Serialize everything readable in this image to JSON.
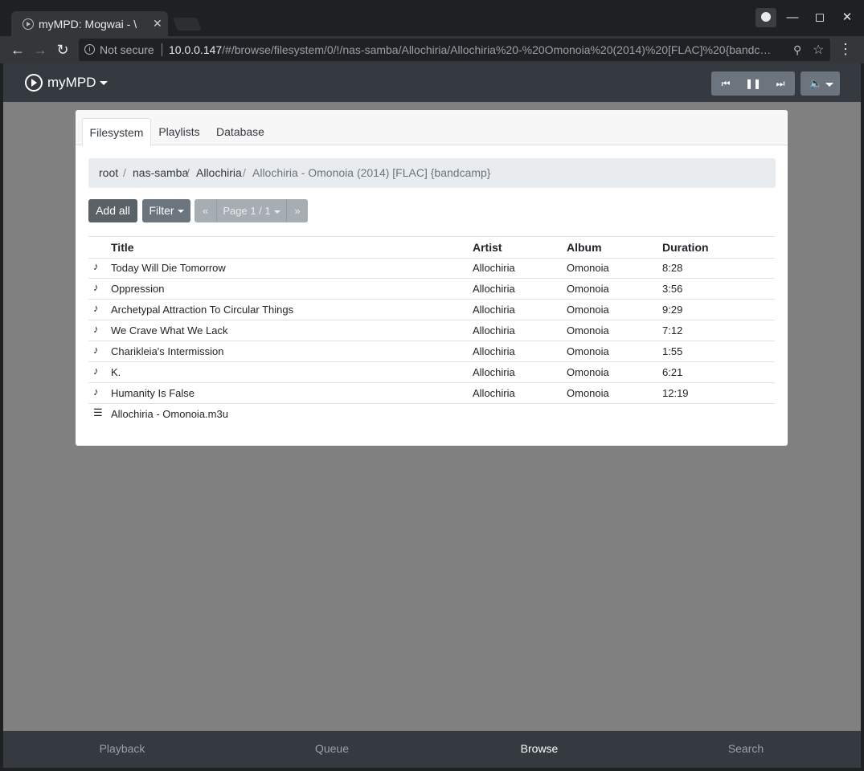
{
  "browser": {
    "tab_title": "myMPD: Mogwai - \\",
    "tab_close": "✕",
    "security_label": "Not secure",
    "url_host": "10.0.0.147",
    "url_path": "/#/browse/filesystem/0/!/nas-samba/Allochiria/Allochiria%20-%20Omonoia%20(2014)%20[FLAC]%20{bandc…"
  },
  "app": {
    "brand": "myMPD",
    "tabs": [
      "Filesystem",
      "Playlists",
      "Database"
    ],
    "active_tab": "Filesystem",
    "breadcrumb": [
      "root",
      "nas-samba",
      "Allochiria",
      "Allochiria - Omonoia (2014) [FLAC] {bandcamp}"
    ],
    "toolbar": {
      "add_all": "Add all",
      "filter": "Filter",
      "page_prev": "«",
      "page_label": "Page 1 / 1",
      "page_next": "»"
    },
    "table": {
      "headers": [
        "Title",
        "Artist",
        "Album",
        "Duration"
      ],
      "rows": [
        {
          "icon": "♪",
          "title": "Today Will Die Tomorrow",
          "artist": "Allochiria",
          "album": "Omonoia",
          "duration": "8:28"
        },
        {
          "icon": "♪",
          "title": "Oppression",
          "artist": "Allochiria",
          "album": "Omonoia",
          "duration": "3:56"
        },
        {
          "icon": "♪",
          "title": "Archetypal Attraction To Circular Things",
          "artist": "Allochiria",
          "album": "Omonoia",
          "duration": "9:29"
        },
        {
          "icon": "♪",
          "title": "We Crave What We Lack",
          "artist": "Allochiria",
          "album": "Omonoia",
          "duration": "7:12"
        },
        {
          "icon": "♪",
          "title": "Charikleia's Intermission",
          "artist": "Allochiria",
          "album": "Omonoia",
          "duration": "1:55"
        },
        {
          "icon": "♪",
          "title": "K.",
          "artist": "Allochiria",
          "album": "Omonoia",
          "duration": "6:21"
        },
        {
          "icon": "♪",
          "title": "Humanity Is False",
          "artist": "Allochiria",
          "album": "Omonoia",
          "duration": "12:19"
        },
        {
          "icon": "☰",
          "title": "Allochiria - Omonoia.m3u",
          "artist": "",
          "album": "",
          "duration": ""
        }
      ]
    },
    "footer": [
      "Playback",
      "Queue",
      "Browse",
      "Search"
    ],
    "footer_active": "Browse"
  },
  "colors": {
    "navbar": "#343a40",
    "backdrop": "#808080",
    "button": "#6c757d"
  }
}
